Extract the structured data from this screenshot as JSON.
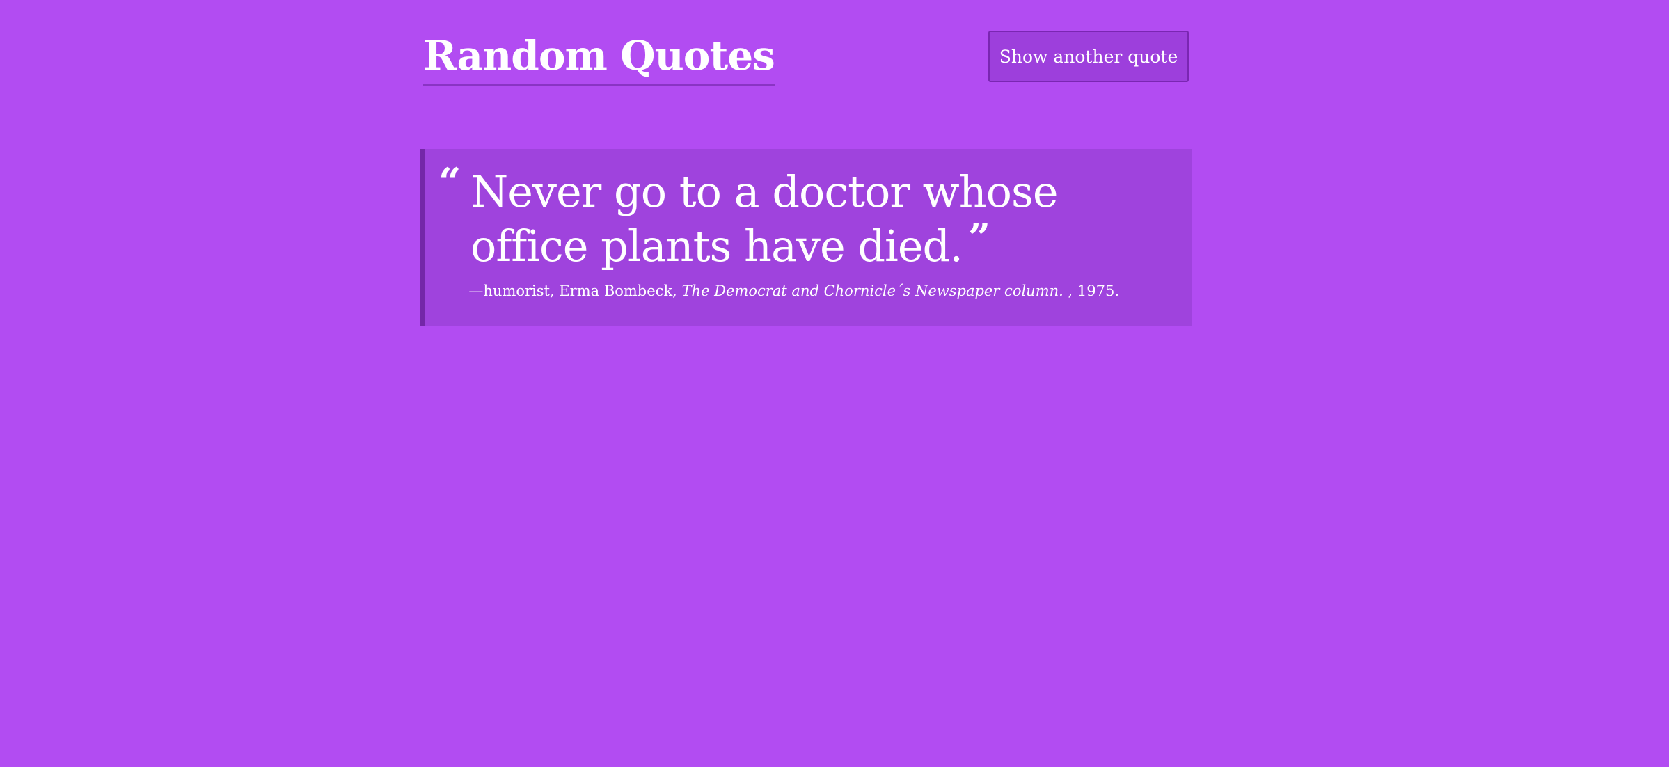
{
  "header": {
    "title": "Random Quotes",
    "new_quote_label": "Show another quote"
  },
  "quote": {
    "open_mark": "“",
    "text": "Never go to a doctor whose office plants have died.",
    "close_mark": "”",
    "dash": "—",
    "role": "humorist",
    "author": "Erma Bombeck",
    "source": "The Democrat and Chornicle´s Newspaper column.",
    "year": "1975"
  },
  "colors": {
    "background": "#b24cf2",
    "quote_box": "#9f43dd",
    "accent_border": "#7427a8",
    "button": "#9d3fdc",
    "text": "#ffffff"
  }
}
